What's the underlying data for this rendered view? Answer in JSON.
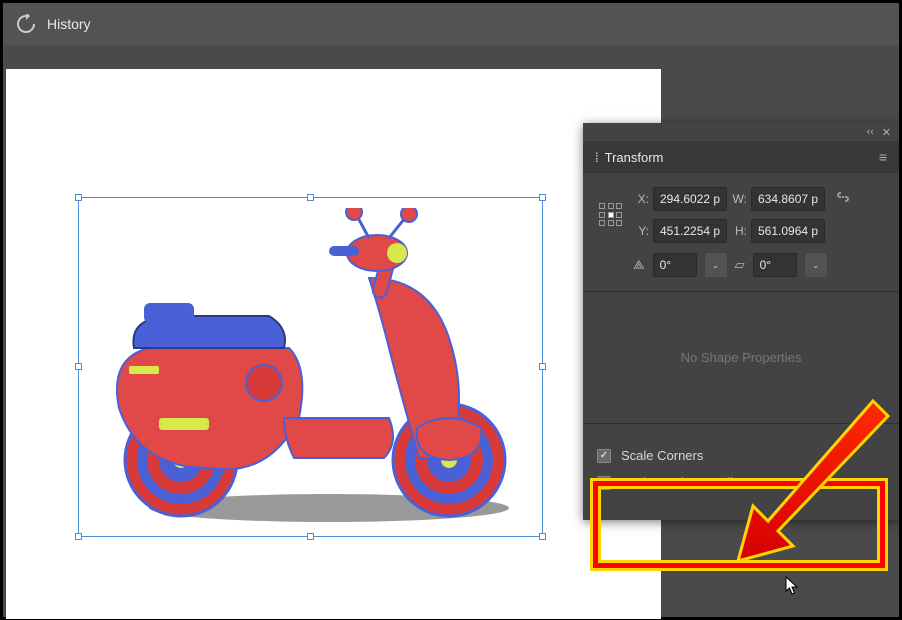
{
  "topbar": {
    "tab_label": "History"
  },
  "transform": {
    "title": "Transform",
    "x_label": "X:",
    "x_value": "294.6022 p",
    "y_label": "Y:",
    "y_value": "451.2254 p",
    "w_label": "W:",
    "w_value": "634.8607 p",
    "h_label": "H:",
    "h_value": "561.0964 p",
    "rotate_value": "0°",
    "shear_value": "0°",
    "no_shape": "No Shape Properties",
    "scale_corners": "Scale Corners",
    "scale_strokes": "Scale Strokes & Effects"
  }
}
